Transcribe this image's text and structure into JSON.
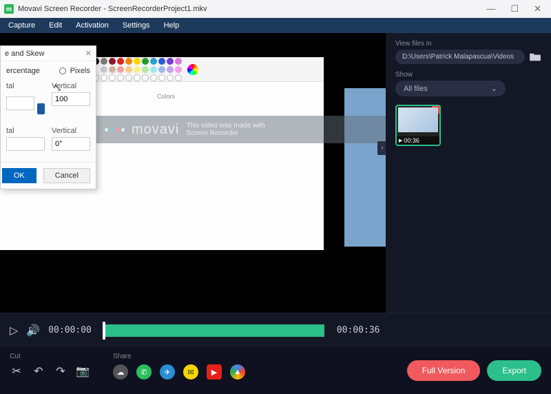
{
  "title": {
    "app": "Movavi Screen Recorder",
    "file": "ScreenRecorderProject1.mkv"
  },
  "winControls": {
    "min": "—",
    "max": "☐",
    "close": "✕"
  },
  "menu": [
    "Capture",
    "Edit",
    "Activation",
    "Settings",
    "Help"
  ],
  "side": {
    "viewLabel": "View files in",
    "path": "D:\\Users\\Patrick Malapascua\\Videos",
    "showLabel": "Show",
    "showValue": "All files",
    "chevron": "⌄",
    "thumb": {
      "duration": "00:36",
      "close": "✕"
    }
  },
  "paint": {
    "colorsLabel": "Colors",
    "row1": [
      "#000",
      "#7a7a7a",
      "#8a1a2a",
      "#d22",
      "#e88a00",
      "#f6d600",
      "#2a9a2a",
      "#2aa0d6",
      "#2a5ad6",
      "#7a3ad6",
      "#d67ad6"
    ],
    "row2": [
      "#fff",
      "#c8c8c8",
      "#d6b0a0",
      "#f0a0a0",
      "#f6cc88",
      "#f6f088",
      "#b8e8a0",
      "#a0e8f0",
      "#a0b8f0",
      "#c8a0f0",
      "#f0a0e8"
    ]
  },
  "dialog": {
    "title": "e and Skew",
    "close": "✕",
    "radioPct": "ercentage",
    "radioPx": "Pixels",
    "col1": "tal",
    "col2": "Vertical",
    "val2": "100",
    "col3": "tal",
    "col4": "Vertical",
    "val4": "0°",
    "ok": "OK",
    "cancel": "Cancel"
  },
  "watermark": {
    "brand": "movavi",
    "line1": "This video was made with",
    "line2": "Screen Recorder"
  },
  "expand": "›",
  "player": {
    "play": "▷",
    "vol": "🔊",
    "cur": "00:00:00",
    "dur": "00:00:36"
  },
  "bottom": {
    "cutLabel": "Cut",
    "shareLabel": "Share",
    "cutIcons": {
      "scissors": "✂",
      "undo": "↶",
      "redo": "↷",
      "camera": "📷"
    },
    "fullVersion": "Full Version",
    "export": "Export"
  }
}
